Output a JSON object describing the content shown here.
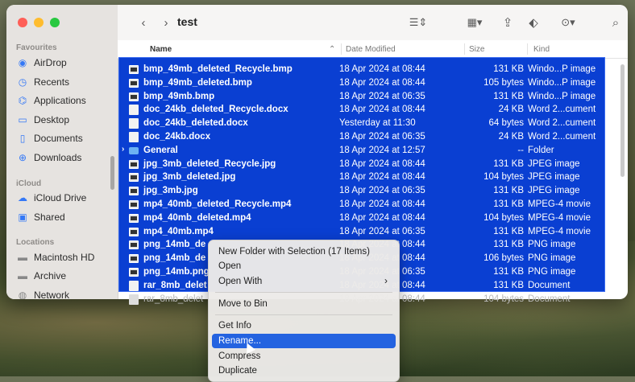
{
  "window": {
    "title": "test"
  },
  "sidebar": {
    "favourites_label": "Favourites",
    "favourites": [
      {
        "label": "AirDrop",
        "icon": "airdrop-icon"
      },
      {
        "label": "Recents",
        "icon": "clock-icon"
      },
      {
        "label": "Applications",
        "icon": "applications-icon"
      },
      {
        "label": "Desktop",
        "icon": "desktop-icon"
      },
      {
        "label": "Documents",
        "icon": "document-icon"
      },
      {
        "label": "Downloads",
        "icon": "download-icon"
      }
    ],
    "icloud_label": "iCloud",
    "icloud": [
      {
        "label": "iCloud Drive",
        "icon": "cloud-icon"
      },
      {
        "label": "Shared",
        "icon": "shared-folder-icon"
      }
    ],
    "locations_label": "Locations",
    "locations": [
      {
        "label": "Macintosh HD",
        "icon": "drive-icon"
      },
      {
        "label": "Archive",
        "icon": "drive-icon"
      },
      {
        "label": "Network",
        "icon": "network-icon"
      }
    ]
  },
  "columns": {
    "name": "Name",
    "date": "Date Modified",
    "size": "Size",
    "kind": "Kind"
  },
  "files": [
    {
      "name": "bmp_49mb_deleted_Recycle.bmp",
      "date": "18 Apr 2024 at 08:44",
      "size": "131 KB",
      "kind": "Windo...P image",
      "icon": "image-file-icon"
    },
    {
      "name": "bmp_49mb_deleted.bmp",
      "date": "18 Apr 2024 at 08:44",
      "size": "105 bytes",
      "kind": "Windo...P image",
      "icon": "image-file-icon"
    },
    {
      "name": "bmp_49mb.bmp",
      "date": "18 Apr 2024 at 06:35",
      "size": "131 KB",
      "kind": "Windo...P image",
      "icon": "image-file-icon"
    },
    {
      "name": "doc_24kb_deleted_Recycle.docx",
      "date": "18 Apr 2024 at 08:44",
      "size": "24 KB",
      "kind": "Word 2...cument",
      "icon": "document-file-icon"
    },
    {
      "name": "doc_24kb_deleted.docx",
      "date": "Yesterday at 11:30",
      "size": "64 bytes",
      "kind": "Word 2...cument",
      "icon": "document-file-icon"
    },
    {
      "name": "doc_24kb.docx",
      "date": "18 Apr 2024 at 06:35",
      "size": "24 KB",
      "kind": "Word 2...cument",
      "icon": "document-file-icon"
    },
    {
      "name": "General",
      "date": "18 Apr 2024 at 12:57",
      "size": "--",
      "kind": "Folder",
      "icon": "folder-icon"
    },
    {
      "name": "jpg_3mb_deleted_Recycle.jpg",
      "date": "18 Apr 2024 at 08:44",
      "size": "131 KB",
      "kind": "JPEG image",
      "icon": "image-file-icon"
    },
    {
      "name": "jpg_3mb_deleted.jpg",
      "date": "18 Apr 2024 at 08:44",
      "size": "104 bytes",
      "kind": "JPEG image",
      "icon": "image-file-icon"
    },
    {
      "name": "jpg_3mb.jpg",
      "date": "18 Apr 2024 at 06:35",
      "size": "131 KB",
      "kind": "JPEG image",
      "icon": "image-file-icon"
    },
    {
      "name": "mp4_40mb_deleted_Recycle.mp4",
      "date": "18 Apr 2024 at 08:44",
      "size": "131 KB",
      "kind": "MPEG-4 movie",
      "icon": "movie-file-icon"
    },
    {
      "name": "mp4_40mb_deleted.mp4",
      "date": "18 Apr 2024 at 08:44",
      "size": "104 bytes",
      "kind": "MPEG-4 movie",
      "icon": "movie-file-icon"
    },
    {
      "name": "mp4_40mb.mp4",
      "date": "18 Apr 2024 at 06:35",
      "size": "131 KB",
      "kind": "MPEG-4 movie",
      "icon": "movie-file-icon"
    },
    {
      "name": "png_14mb_de",
      "date": "18 Apr 2024 at 08:44",
      "size": "131 KB",
      "kind": "PNG image",
      "icon": "image-file-icon"
    },
    {
      "name": "png_14mb_de",
      "date": "18 Apr 2024 at 08:44",
      "size": "106 bytes",
      "kind": "PNG image",
      "icon": "image-file-icon"
    },
    {
      "name": "png_14mb.png",
      "date": "18 Apr 2024 at 06:35",
      "size": "131 KB",
      "kind": "PNG image",
      "icon": "image-file-icon"
    },
    {
      "name": "rar_8mb_delet",
      "date": "18 Apr 2024 at 08:44",
      "size": "131 KB",
      "kind": "Document",
      "icon": "document-file-icon"
    }
  ],
  "partial_row": {
    "name": "rar_8mb_delet",
    "date": "18 Apr 2024 at 08:44",
    "size": "104 bytes",
    "kind": "Document"
  },
  "context_menu": {
    "items": [
      {
        "label": "New Folder with Selection (17 Items)"
      },
      {
        "label": "Open"
      },
      {
        "label": "Open With",
        "submenu": true
      },
      {
        "label": "Move to Bin"
      },
      {
        "label": "Get Info"
      },
      {
        "label": "Rename...",
        "highlighted": true
      },
      {
        "label": "Compress"
      },
      {
        "label": "Duplicate"
      }
    ]
  },
  "colors": {
    "selection": "#0a3fd2",
    "menu_highlight": "#2463e0",
    "accent": "#3478f6"
  }
}
